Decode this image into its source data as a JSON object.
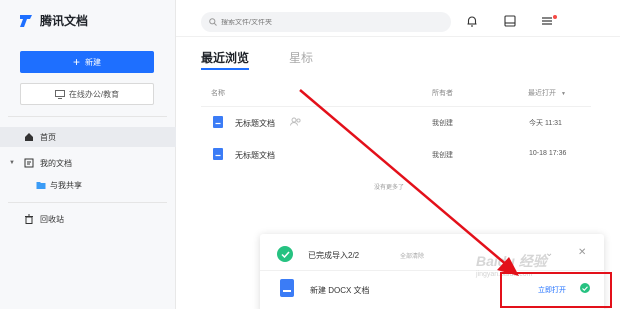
{
  "sidebar": {
    "brand": "腾讯文档",
    "new_button": "新建",
    "edu_button": "在线办公/教育",
    "nav": {
      "home": "首页",
      "my_docs": "我的文档",
      "shared": "与我共享",
      "trash": "回收站"
    }
  },
  "header": {
    "search_placeholder": "搜索文件/文件夹"
  },
  "tabs": {
    "recent": "最近浏览",
    "starred": "星标"
  },
  "table": {
    "headers": {
      "name": "名称",
      "owner": "所有者",
      "recent_open": "最近打开"
    },
    "rows": [
      {
        "name": "无标题文档",
        "owner": "我创建",
        "time": "今天 11:31"
      },
      {
        "name": "无标题文档",
        "owner": "我创建",
        "time": "10-18 17:36"
      }
    ],
    "no_more": "没有更多了"
  },
  "popup": {
    "status": "已完成导入2/2",
    "clear": "全部清除",
    "file_name": "新建 DOCX 文档",
    "open_link": "立即打开"
  },
  "watermark": {
    "main": "Baidu 经验",
    "sub": "jingyan.baidu.com"
  },
  "colors": {
    "accent": "#1e6fff",
    "success": "#26c281",
    "annotation_red": "#e3101a"
  }
}
